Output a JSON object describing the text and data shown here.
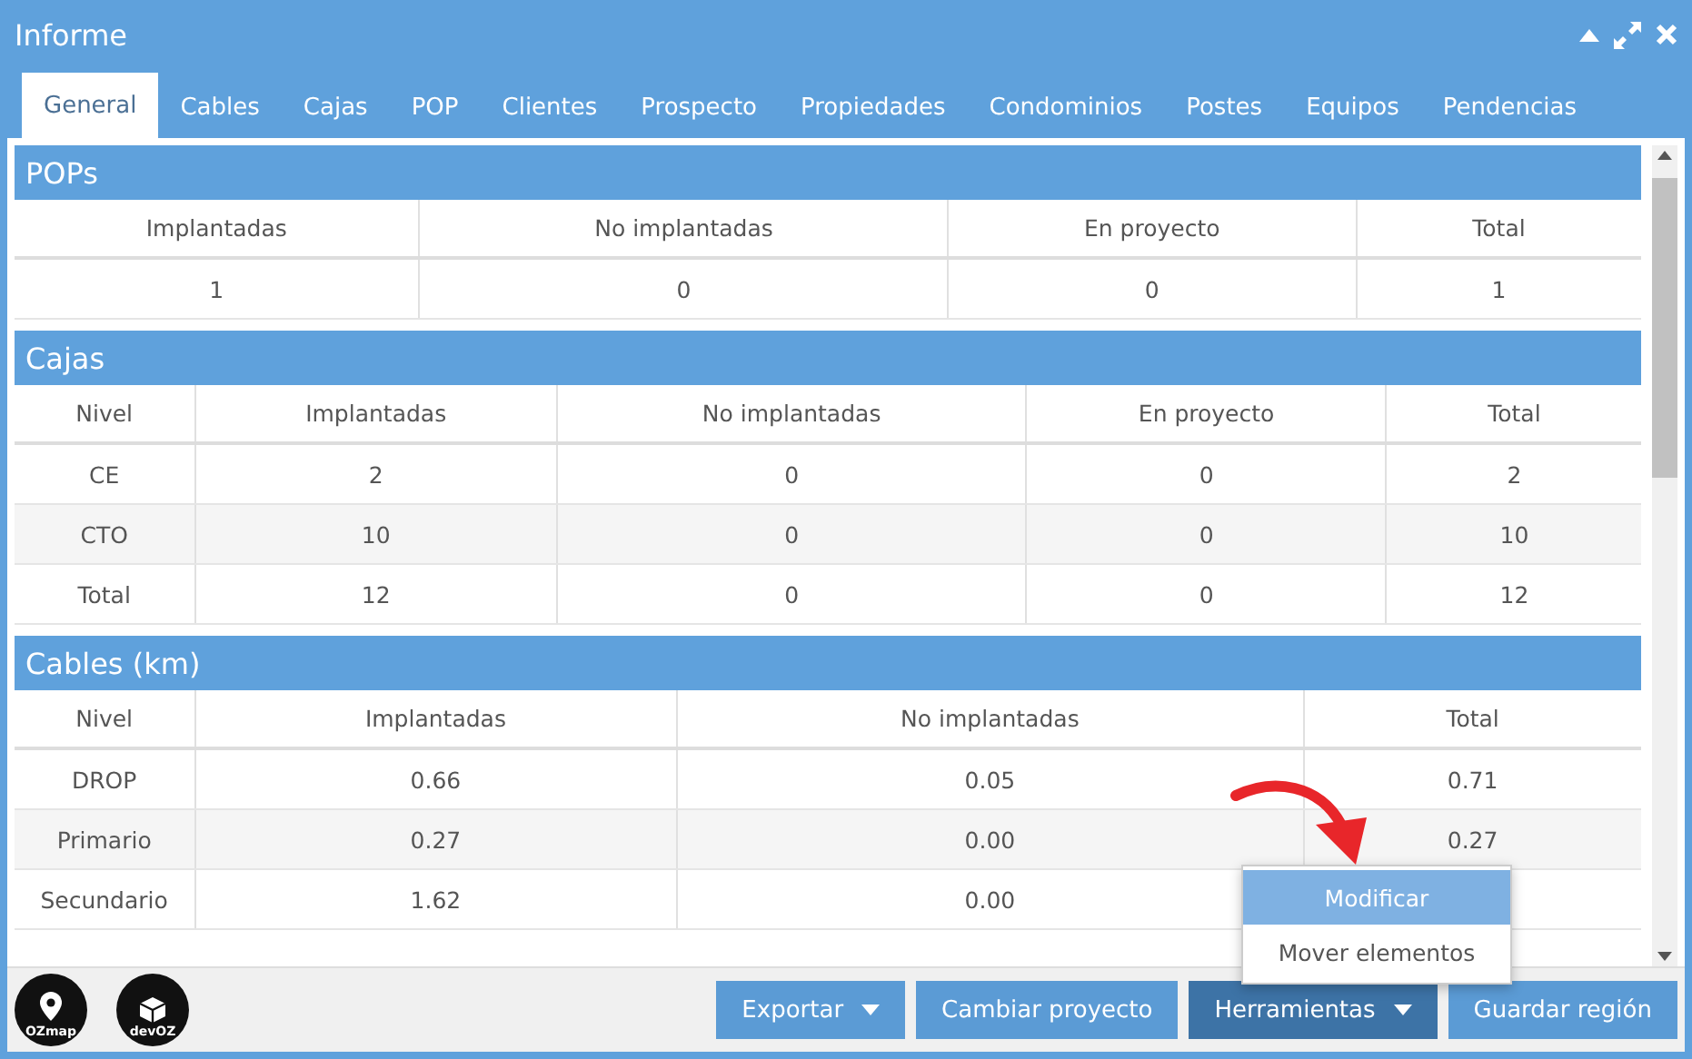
{
  "window": {
    "title": "Informe"
  },
  "tabs": [
    {
      "label": "General",
      "selected": true
    },
    {
      "label": "Cables",
      "selected": false
    },
    {
      "label": "Cajas",
      "selected": false
    },
    {
      "label": "POP",
      "selected": false
    },
    {
      "label": "Clientes",
      "selected": false
    },
    {
      "label": "Prospecto",
      "selected": false
    },
    {
      "label": "Propiedades",
      "selected": false
    },
    {
      "label": "Condominios",
      "selected": false
    },
    {
      "label": "Postes",
      "selected": false
    },
    {
      "label": "Equipos",
      "selected": false
    },
    {
      "label": "Pendencias",
      "selected": false
    }
  ],
  "sections": [
    {
      "title": "POPs",
      "columns": [
        "Implantadas",
        "No implantadas",
        "En proyecto",
        "Total"
      ],
      "rows": [
        [
          "1",
          "0",
          "0",
          "1"
        ]
      ]
    },
    {
      "title": "Cajas",
      "columns": [
        "Nivel",
        "Implantadas",
        "No implantadas",
        "En proyecto",
        "Total"
      ],
      "rows": [
        [
          "CE",
          "2",
          "0",
          "0",
          "2"
        ],
        [
          "CTO",
          "10",
          "0",
          "0",
          "10"
        ],
        [
          "Total",
          "12",
          "0",
          "0",
          "12"
        ]
      ]
    },
    {
      "title": "Cables (km)",
      "columns": [
        "Nivel",
        "Implantadas",
        "No implantadas",
        "Total"
      ],
      "rows": [
        [
          "DROP",
          "0.66",
          "0.05",
          "0.71"
        ],
        [
          "Primario",
          "0.27",
          "0.00",
          "0.27"
        ],
        [
          "Secundario",
          "1.62",
          "0.00"
        ]
      ]
    }
  ],
  "logos": [
    "OZmap",
    "devOZ"
  ],
  "buttons": [
    {
      "label": "Exportar",
      "dropdown": true,
      "expanded": false
    },
    {
      "label": "Cambiar proyecto",
      "dropdown": false,
      "expanded": false
    },
    {
      "label": "Herramientas",
      "dropdown": true,
      "expanded": true
    },
    {
      "label": "Guardar región",
      "dropdown": false,
      "expanded": false
    }
  ],
  "menu": [
    {
      "label": "Modificar",
      "selected": true
    },
    {
      "label": "Mover elementos",
      "selected": false
    }
  ]
}
